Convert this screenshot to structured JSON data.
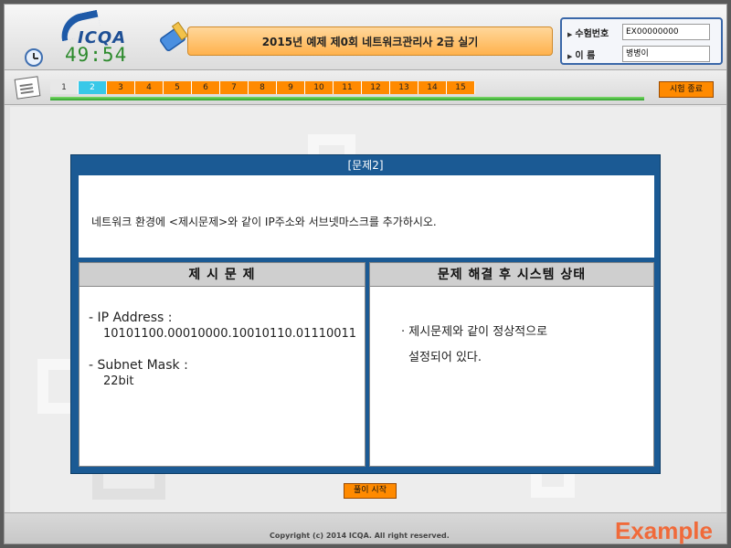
{
  "header": {
    "logo_text": "ICQA",
    "timer": "49:54",
    "title": "2015년 예제 제0회 네트워크관리사 2급 실기",
    "exam_number_label": "수험번호",
    "exam_number_value": "EX00000000",
    "name_label": "이  름",
    "name_value": "병병이"
  },
  "nav": {
    "questions": [
      {
        "label": "1",
        "state": "done"
      },
      {
        "label": "2",
        "state": "current"
      },
      {
        "label": "3",
        "state": "todo"
      },
      {
        "label": "4",
        "state": "todo"
      },
      {
        "label": "5",
        "state": "todo"
      },
      {
        "label": "6",
        "state": "todo"
      },
      {
        "label": "7",
        "state": "todo"
      },
      {
        "label": "8",
        "state": "todo"
      },
      {
        "label": "9",
        "state": "todo"
      },
      {
        "label": "10",
        "state": "todo"
      },
      {
        "label": "11",
        "state": "todo"
      },
      {
        "label": "12",
        "state": "todo"
      },
      {
        "label": "13",
        "state": "todo"
      },
      {
        "label": "14",
        "state": "todo"
      },
      {
        "label": "15",
        "state": "todo"
      }
    ],
    "end_button": "시험 종료"
  },
  "question": {
    "title": "[문제2]",
    "text": "네트워크 환경에 <제시문제>와 같이 IP주소와 서브넷마스크를 추가하시오.",
    "left_header": "제 시 문 제",
    "right_header": "문제 해결 후 시스템 상태",
    "ip_label": "- IP Address :",
    "ip_value": "10101100.00010000.10010110.01110011",
    "mask_label": "- Subnet Mask :",
    "mask_value": "22bit",
    "state_line1": "· 제시문제와 같이 정상적으로",
    "state_line2": "설정되어 있다."
  },
  "start_button": "풀이 시작",
  "footer": {
    "copyright": "Copyright (c) 2014 ICQA. All right reserved.",
    "watermark": "Example"
  },
  "colors": {
    "accent_orange": "#ff8a00",
    "current_tab": "#39c8e8",
    "panel_blue": "#1b5a94",
    "timer_green": "#2c8a2c"
  }
}
